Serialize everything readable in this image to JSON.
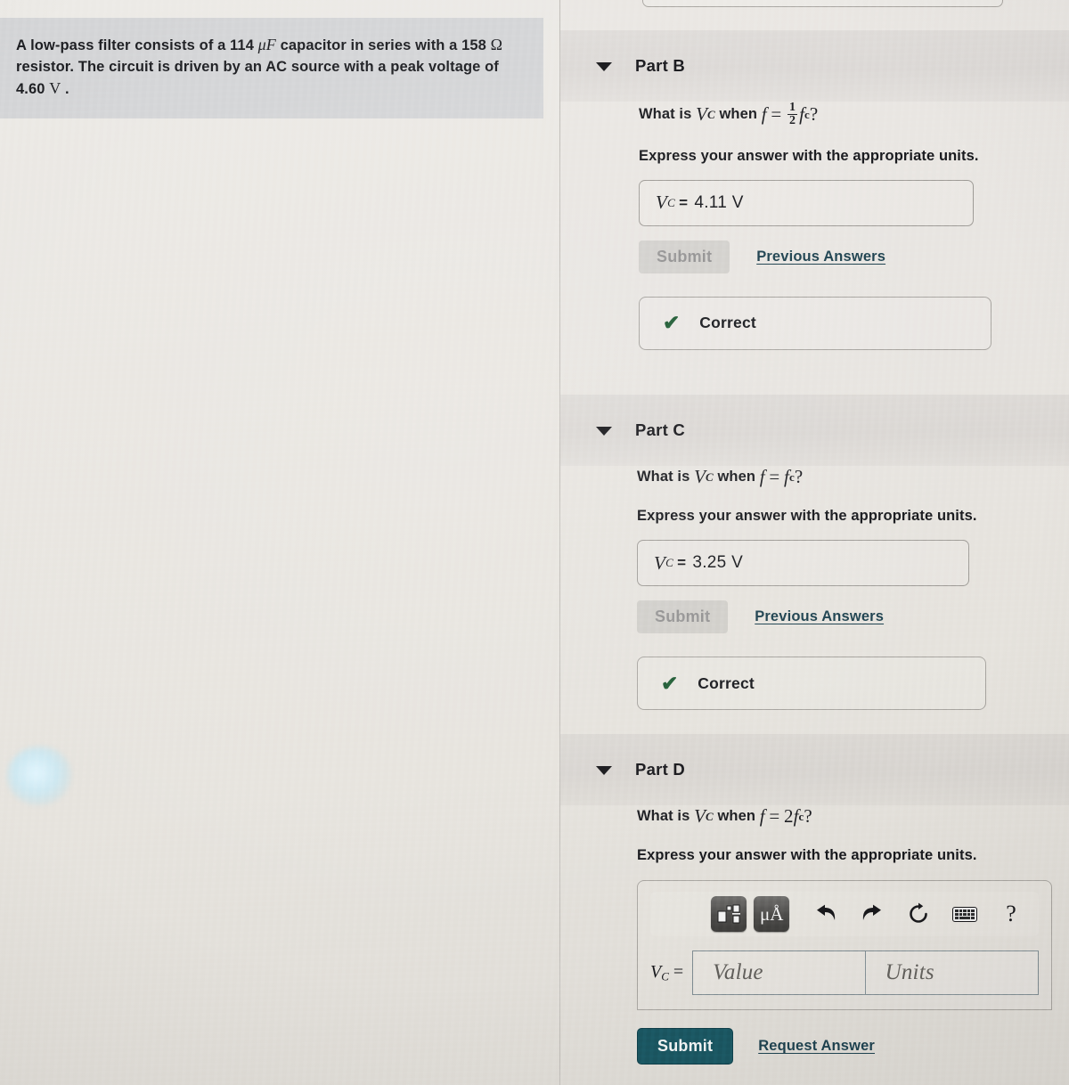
{
  "problem": {
    "text_before_cap": "A low-pass filter consists of a 114 ",
    "cap_unit": "μF",
    "text_mid": " capacitor in series with a 158 ",
    "ohm_unit": "Ω",
    "text_after": "resistor. The circuit is driven by an AC source with a peak voltage of",
    "voltage_value": "4.60",
    "voltage_unit": "V",
    "trailing": "."
  },
  "parts": [
    {
      "id": "part-b",
      "title": "Part B",
      "disclosure": "triangle-down-icon",
      "question_prefix": "What is",
      "question_var": "V",
      "question_var_sub": "C",
      "question_mid": "when",
      "question_f": "f",
      "question_eq": "=",
      "frac_num": "1",
      "frac_den": "2",
      "question_fc": "f",
      "question_fc_sub": "c",
      "question_suffix": "?",
      "express": "Express your answer with the appropriate units.",
      "answer_label": "V",
      "answer_label_sub": "C",
      "answer_eq": "=",
      "answer_value": "4.11 V",
      "submit_label": "Submit",
      "previous_answers_label": "Previous Answers",
      "feedback_icon": "check-icon",
      "feedback_text": "Correct"
    },
    {
      "id": "part-c",
      "title": "Part C",
      "disclosure": "triangle-down-icon",
      "question_prefix": "What is",
      "question_var": "V",
      "question_var_sub": "C",
      "question_mid": "when",
      "question_f": "f",
      "question_eq": "=",
      "frac_num": "",
      "frac_den": "",
      "question_fc": "f",
      "question_fc_sub": "c",
      "question_suffix": "?",
      "express": "Express your answer with the appropriate units.",
      "answer_label": "V",
      "answer_label_sub": "C",
      "answer_eq": "=",
      "answer_value": "3.25 V",
      "submit_label": "Submit",
      "previous_answers_label": "Previous Answers",
      "feedback_icon": "check-icon",
      "feedback_text": "Correct"
    },
    {
      "id": "part-d",
      "title": "Part D",
      "disclosure": "triangle-down-icon",
      "question_prefix": "What is",
      "question_var": "V",
      "question_var_sub": "C",
      "question_mid": "when",
      "question_f": "f",
      "question_eq": "=",
      "coefficient": "2",
      "question_fc": "f",
      "question_fc_sub": "c",
      "question_suffix": "?",
      "express": "Express your answer with the appropriate units."
    }
  ],
  "answer_widget": {
    "toolbar": [
      {
        "name": "template-fraction-icon",
        "label": ""
      },
      {
        "name": "micro-angstrom-units-icon",
        "label": "μÅ"
      },
      {
        "name": "undo-icon",
        "label": ""
      },
      {
        "name": "redo-icon",
        "label": ""
      },
      {
        "name": "reset-icon",
        "label": ""
      },
      {
        "name": "keyboard-icon",
        "label": ""
      },
      {
        "name": "help-icon",
        "label": "?"
      }
    ],
    "entry_label": "V",
    "entry_label_sub": "C",
    "entry_eq": "=",
    "value_placeholder": "Value",
    "units_placeholder": "Units",
    "submit_label": "Submit",
    "request_answer_label": "Request Answer"
  },
  "colors": {
    "page_bg": "#e7e4df",
    "problem_box_bg": "#d3d4d6",
    "link": "#1c3f4c",
    "submit_active_bg": "#19545f",
    "correct_check": "#1f5a33",
    "text": "#17181c"
  }
}
